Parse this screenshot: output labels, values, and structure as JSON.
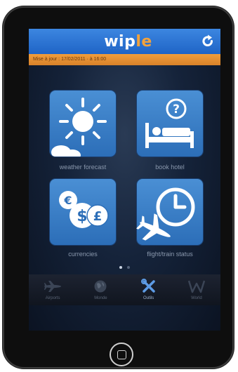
{
  "app": {
    "logo_main": "wip",
    "logo_accent": "le",
    "logo_tagline": "· · · · · · ·"
  },
  "status_bar": {
    "text": "Mise à jour : 17/02/2011 · à 16:00"
  },
  "tiles": [
    {
      "label": "weather forecast",
      "icon": "sun-cloud-icon"
    },
    {
      "label": "book hotel",
      "icon": "hotel-bed-icon"
    },
    {
      "label": "currencies",
      "icon": "currency-coins-icon"
    },
    {
      "label": "flight/train status",
      "icon": "plane-clock-icon"
    }
  ],
  "page_indicator": {
    "pages": 2,
    "active": 1
  },
  "tabbar": [
    {
      "label": "Airports",
      "icon": "airplane-icon",
      "active": false
    },
    {
      "label": "Monde",
      "icon": "globe-icon",
      "active": false
    },
    {
      "label": "Outils",
      "icon": "tools-icon",
      "active": true
    },
    {
      "label": "World",
      "icon": "w-icon",
      "active": false
    }
  ],
  "colors": {
    "header_blue": "#2a73d2",
    "status_orange": "#e8912f",
    "tile_blue": "#3a7fc6",
    "screen_dark": "#15233a"
  }
}
